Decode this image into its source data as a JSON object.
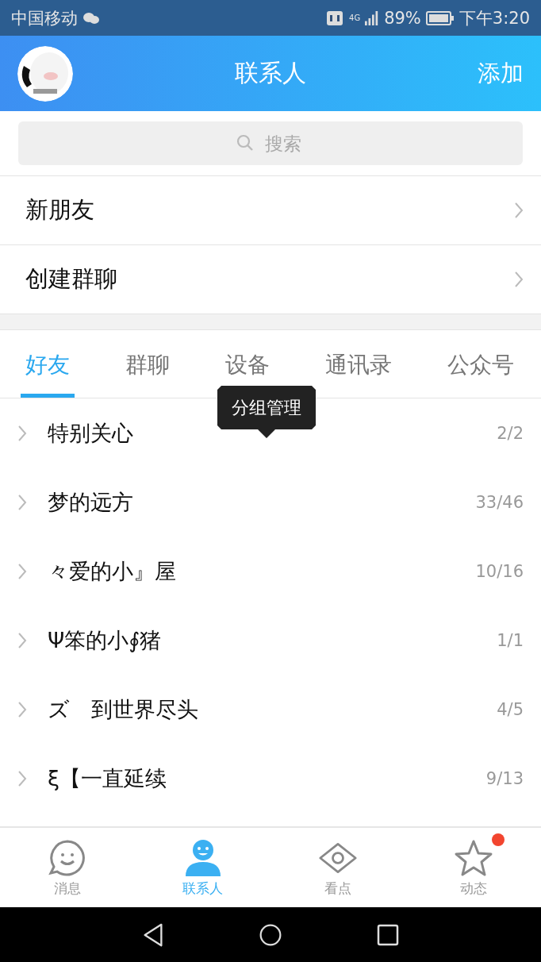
{
  "status_bar": {
    "carrier": "中国移动",
    "network": "4G",
    "battery": "89%",
    "time": "下午3:20"
  },
  "header": {
    "title": "联系人",
    "action": "添加"
  },
  "search": {
    "placeholder": "搜索"
  },
  "menu_items": [
    {
      "label": "新朋友"
    },
    {
      "label": "创建群聊"
    }
  ],
  "tabs": [
    {
      "label": "好友",
      "selected": true
    },
    {
      "label": "群聊",
      "selected": false
    },
    {
      "label": "设备",
      "selected": false
    },
    {
      "label": "通讯录",
      "selected": false
    },
    {
      "label": "公众号",
      "selected": false
    }
  ],
  "tooltip": "分组管理",
  "groups": [
    {
      "name": "特别关心",
      "count": "2/2"
    },
    {
      "name": "梦的远方",
      "count": "33/46"
    },
    {
      "name": "々爱的小』屋",
      "count": "10/16"
    },
    {
      "name": "Ψ笨的小∮猪",
      "count": "1/1"
    },
    {
      "name": "ズ　到世界尽头",
      "count": "4/5"
    },
    {
      "name": "ξ【一直延续",
      "count": "9/13"
    }
  ],
  "bottom_nav": [
    {
      "label": "消息",
      "kind": "chat",
      "selected": false,
      "badge": false
    },
    {
      "label": "联系人",
      "kind": "contact",
      "selected": true,
      "badge": false
    },
    {
      "label": "看点",
      "kind": "eye",
      "selected": false,
      "badge": false
    },
    {
      "label": "动态",
      "kind": "star",
      "selected": false,
      "badge": true
    }
  ]
}
